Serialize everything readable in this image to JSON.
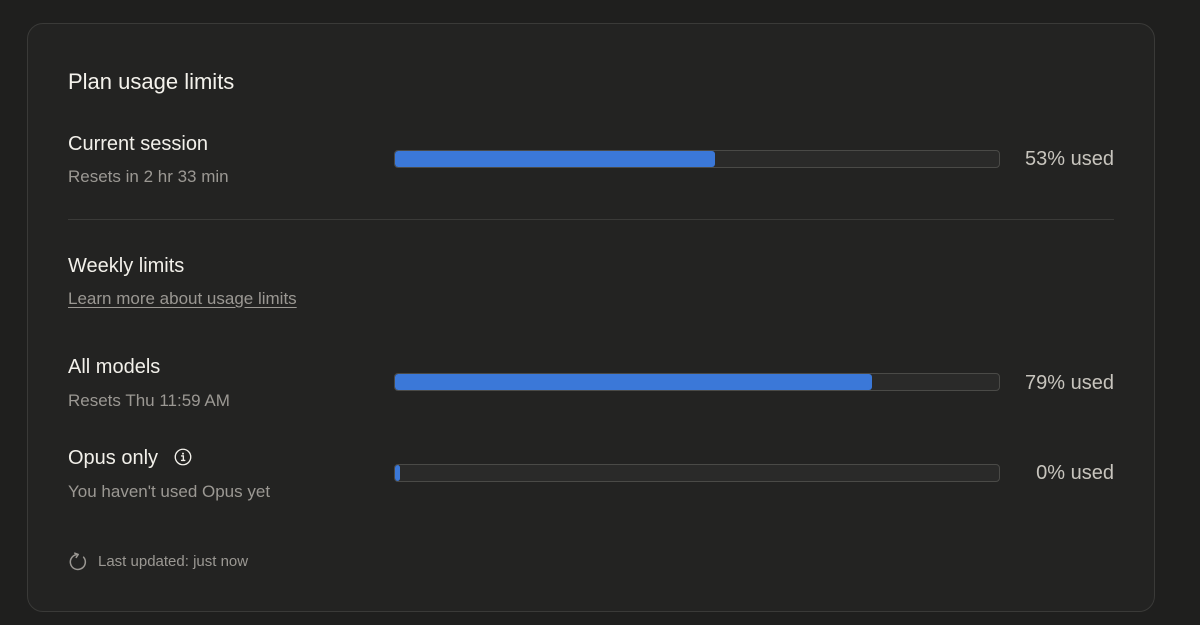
{
  "colors": {
    "background": "#1f1f1e",
    "card": "#232322",
    "bar_fill": "#3b78d8",
    "bar_track": "#2a2a29",
    "muted_text": "#9b9893"
  },
  "header": {
    "title": "Plan usage limits"
  },
  "current_session": {
    "label": "Current session",
    "subtitle": "Resets in 2 hr 33 min",
    "percent": 53,
    "percent_label": "53% used"
  },
  "weekly": {
    "label": "Weekly limits",
    "link_text": "Learn more about usage limits",
    "all_models": {
      "label": "All models",
      "subtitle": "Resets Thu 11:59 AM",
      "percent": 79,
      "percent_label": "79% used"
    },
    "opus_only": {
      "label": "Opus only",
      "subtitle": "You haven't used Opus yet",
      "percent": 0,
      "percent_label": "0% used",
      "icon": "info-icon"
    }
  },
  "footer": {
    "icon": "refresh-icon",
    "text": "Last updated: just now"
  }
}
